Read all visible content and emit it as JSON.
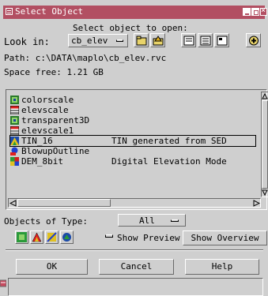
{
  "window": {
    "title": "Select Object",
    "accent": "#b24f62"
  },
  "header": {
    "prompt": "Select object to open:",
    "look_in_label": "Look in:",
    "look_in_value": "cb_elev",
    "path": "Path: c:\\DATA\\maplo\\cb_elev.rvc",
    "space_free": "Space free: 1.21 GB"
  },
  "toolbar": {
    "icons": [
      "folder-up-icon",
      "new-folder-icon",
      "list-view-icon",
      "detail-view-icon",
      "properties-view-icon",
      "add-icon"
    ]
  },
  "objects": [
    {
      "name": "colorscale",
      "description": "",
      "icon": "raster-icon",
      "selected": false
    },
    {
      "name": "elevscale",
      "description": "",
      "icon": "table-icon",
      "selected": false
    },
    {
      "name": "transparent3D",
      "description": "",
      "icon": "raster-icon",
      "selected": false
    },
    {
      "name": "elevscale1",
      "description": "",
      "icon": "table-icon",
      "selected": false
    },
    {
      "name": "TIN_16",
      "description": "TIN generated from SED",
      "icon": "tin-icon",
      "selected": true
    },
    {
      "name": "BlowupOutline",
      "description": "",
      "icon": "vector-icon",
      "selected": false
    },
    {
      "name": "DEM_8bit",
      "description": "Digital Elevation Mode",
      "icon": "dem-icon",
      "selected": false
    }
  ],
  "filter": {
    "label": "Objects of Type:",
    "value": "All"
  },
  "options": {
    "show_preview_label": "Show Preview",
    "show_overview_label": "Show Overview",
    "icons": [
      "raster-filter-icon",
      "vector-filter-icon",
      "cad-filter-icon",
      "tin-filter-icon"
    ]
  },
  "buttons": {
    "ok": "OK",
    "cancel": "Cancel",
    "help": "Help"
  }
}
